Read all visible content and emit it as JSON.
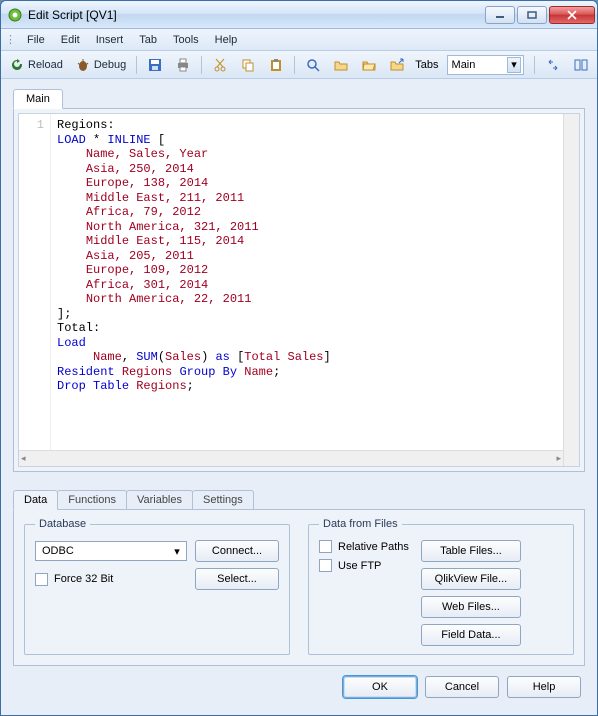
{
  "window": {
    "title": "Edit Script [QV1]"
  },
  "menu": {
    "file": "File",
    "edit": "Edit",
    "insert": "Insert",
    "tab": "Tab",
    "tools": "Tools",
    "help": "Help"
  },
  "toolbar": {
    "reload": "Reload",
    "debug": "Debug",
    "tabs_label": "Tabs",
    "tabs_value": "Main"
  },
  "editor": {
    "tab_label": "Main",
    "gutter_first": "1",
    "lines": [
      {
        "plain": "Regions:"
      },
      {
        "tokens": [
          [
            "kw-blue",
            "LOAD"
          ],
          [
            "",
            " * "
          ],
          [
            "kw-blue",
            "INLINE"
          ],
          [
            "",
            " ["
          ]
        ]
      },
      {
        "tokens": [
          [
            "",
            "    "
          ],
          [
            "kw-red",
            "Name, Sales, Year"
          ]
        ]
      },
      {
        "tokens": [
          [
            "",
            "    "
          ],
          [
            "kw-red",
            "Asia, 250, 2014"
          ]
        ]
      },
      {
        "tokens": [
          [
            "",
            "    "
          ],
          [
            "kw-red",
            "Europe, 138, 2014"
          ]
        ]
      },
      {
        "tokens": [
          [
            "",
            "    "
          ],
          [
            "kw-red",
            "Middle East, 211, 2011"
          ]
        ]
      },
      {
        "tokens": [
          [
            "",
            "    "
          ],
          [
            "kw-red",
            "Africa, 79, 2012"
          ]
        ]
      },
      {
        "tokens": [
          [
            "",
            "    "
          ],
          [
            "kw-red",
            "North America, 321, 2011"
          ]
        ]
      },
      {
        "tokens": [
          [
            "",
            "    "
          ],
          [
            "kw-red",
            "Middle East, 115, 2014"
          ]
        ]
      },
      {
        "tokens": [
          [
            "",
            "    "
          ],
          [
            "kw-red",
            "Asia, 205, 2011"
          ]
        ]
      },
      {
        "tokens": [
          [
            "",
            "    "
          ],
          [
            "kw-red",
            "Europe, 109, 2012"
          ]
        ]
      },
      {
        "tokens": [
          [
            "",
            "    "
          ],
          [
            "kw-red",
            "Africa, 301, 2014"
          ]
        ]
      },
      {
        "tokens": [
          [
            "",
            "    "
          ],
          [
            "kw-red",
            "North America, 22, 2011"
          ]
        ]
      },
      {
        "plain": "];"
      },
      {
        "plain": "Total:"
      },
      {
        "tokens": [
          [
            "kw-blue",
            "Load"
          ]
        ]
      },
      {
        "tokens": [
          [
            "",
            "     "
          ],
          [
            "kw-red",
            "Name"
          ],
          [
            "",
            ", "
          ],
          [
            "kw-blue",
            "SUM"
          ],
          [
            "",
            "("
          ],
          [
            "kw-red",
            "Sales"
          ],
          [
            "",
            ") "
          ],
          [
            "kw-blue",
            "as"
          ],
          [
            "",
            " ["
          ],
          [
            "kw-red",
            "Total Sales"
          ],
          [
            "",
            "]"
          ]
        ]
      },
      {
        "tokens": [
          [
            "kw-blue",
            "Resident"
          ],
          [
            "",
            " "
          ],
          [
            "kw-red",
            "Regions"
          ],
          [
            "",
            " "
          ],
          [
            "kw-blue",
            "Group By"
          ],
          [
            "",
            " "
          ],
          [
            "kw-red",
            "Name"
          ],
          [
            "",
            ";"
          ]
        ]
      },
      {
        "plain": ""
      },
      {
        "tokens": [
          [
            "kw-blue",
            "Drop"
          ],
          [
            "",
            " "
          ],
          [
            "kw-blue",
            "Table"
          ],
          [
            "",
            " "
          ],
          [
            "kw-red",
            "Regions"
          ],
          [
            "",
            ";"
          ]
        ]
      }
    ]
  },
  "bottom": {
    "tabs": {
      "data": "Data",
      "functions": "Functions",
      "variables": "Variables",
      "settings": "Settings"
    },
    "database": {
      "legend": "Database",
      "driver": "ODBC",
      "connect": "Connect...",
      "force32": "Force 32 Bit",
      "select": "Select..."
    },
    "files": {
      "legend": "Data from Files",
      "relative": "Relative Paths",
      "useftp": "Use FTP",
      "table_files": "Table Files...",
      "qlikview_file": "QlikView File...",
      "web_files": "Web Files...",
      "field_data": "Field Data..."
    }
  },
  "dialog": {
    "ok": "OK",
    "cancel": "Cancel",
    "help": "Help"
  }
}
